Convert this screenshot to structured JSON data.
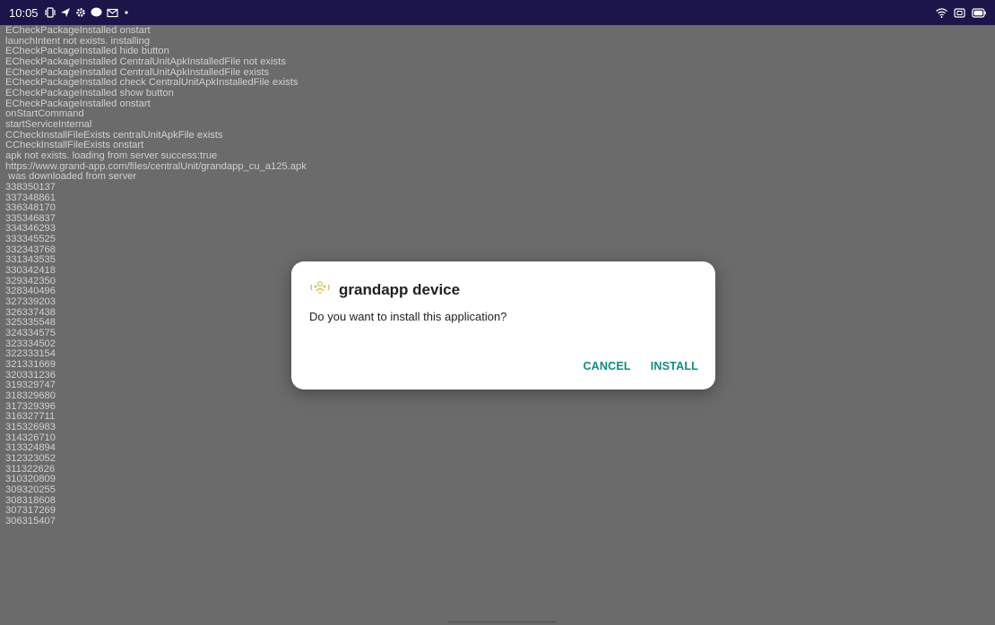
{
  "status_bar": {
    "time": "10:05",
    "left_icons": [
      "vibrate-icon",
      "send-icon",
      "settings-icon",
      "chat-icon",
      "mail-icon",
      "dot-icon"
    ],
    "right_icons": [
      "wifi-icon",
      "screenshot-icon",
      "battery-icon"
    ]
  },
  "log": {
    "lines": [
      "ECheckPackageInstalled onstart",
      "launchIntent not exists. installing",
      "ECheckPackageInstalled hide button",
      "ECheckPackageInstalled CentralUnitApkInstalledFile not exists",
      "ECheckPackageInstalled CentralUnitApkInstalledFile exists",
      "ECheckPackageInstalled check CentralUnitApkInstalledFile exists",
      "ECheckPackageInstalled show button",
      "ECheckPackageInstalled onstart",
      "onStartCommand",
      "startServiceInternal",
      "CCheckInstallFileExists centralUnitApkFile exists",
      "CCheckInstallFileExists onstart",
      "apk not exists. loading from server success:true",
      "https://www.grand-app.com/files/centralUnit/grandapp_cu_a125.apk",
      " was downloaded from server",
      "338350137",
      "337348861",
      "336348170",
      "335346837",
      "334346293",
      "333345525",
      "332343768",
      "331343535",
      "330342418",
      "329342350",
      "328340496",
      "327339203",
      "326337438",
      "325335548",
      "324334575",
      "323334502",
      "322333154",
      "321331669",
      "320331236",
      "319329747",
      "318329680",
      "317329396",
      "316327711",
      "315326983",
      "314326710",
      "313324894",
      "312323052",
      "311322626",
      "310320809",
      "309320255",
      "308318608",
      "307317269",
      "306315407"
    ]
  },
  "dialog": {
    "icon": "grandapp-logo-icon",
    "title": "grandapp device",
    "message": "Do you want to install this application?",
    "cancel_label": "CANCEL",
    "install_label": "INSTALL"
  },
  "colors": {
    "status_bar": "#1c1549",
    "scrim": "#6b6b6b",
    "log_text": "#d0d0d0",
    "accent": "#0f8b7f"
  }
}
